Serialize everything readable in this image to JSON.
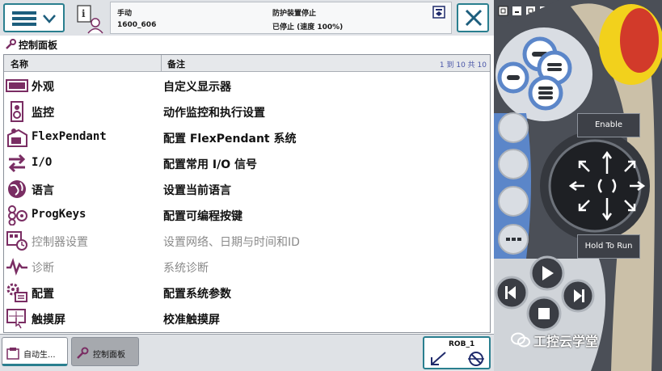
{
  "status": {
    "mode": "手动",
    "system": "1600_606",
    "guard": "防护装置停止",
    "state": "已停止 (速度 100%)"
  },
  "page": {
    "title": "控制面板"
  },
  "table": {
    "col_name": "名称",
    "col_note": "备注",
    "paging": "1 到 10 共 10",
    "rows": [
      {
        "name": "外观",
        "note": "自定义显示器",
        "icon": "appearance-icon",
        "enabled": true
      },
      {
        "name": "监控",
        "note": "动作监控和执行设置",
        "icon": "supervision-icon",
        "enabled": true
      },
      {
        "name": "FlexPendant",
        "note": "配置 FlexPendant 系统",
        "icon": "flexpendant-icon",
        "enabled": true
      },
      {
        "name": "I/O",
        "note": "配置常用 I/O 信号",
        "icon": "io-icon",
        "enabled": true
      },
      {
        "name": "语言",
        "note": "设置当前语言",
        "icon": "language-icon",
        "enabled": true
      },
      {
        "name": "ProgKeys",
        "note": "配置可编程按键",
        "icon": "progkeys-icon",
        "enabled": true
      },
      {
        "name": "控制器设置",
        "note": "设置网络、日期与时间和ID",
        "icon": "controller-settings-icon",
        "enabled": false
      },
      {
        "name": "诊断",
        "note": "系统诊断",
        "icon": "diagnostics-icon",
        "enabled": false
      },
      {
        "name": "配置",
        "note": "配置系统参数",
        "icon": "configuration-icon",
        "enabled": true
      },
      {
        "name": "触摸屏",
        "note": "校准触摸屏",
        "icon": "touchscreen-icon",
        "enabled": true
      }
    ]
  },
  "taskbar": {
    "task1": "自动生...",
    "task2": "控制面板",
    "rob": "ROB_1"
  },
  "pendant": {
    "enable": "Enable",
    "hold_to_run": "Hold To Run"
  },
  "watermark": "工控云学堂",
  "colors": {
    "accent": "#2a7f8f",
    "pendant_body": "#4b4f57",
    "key_blue": "#5b86c9",
    "emergency_yellow": "#f2d11c",
    "emergency_red": "#d23a2a"
  }
}
